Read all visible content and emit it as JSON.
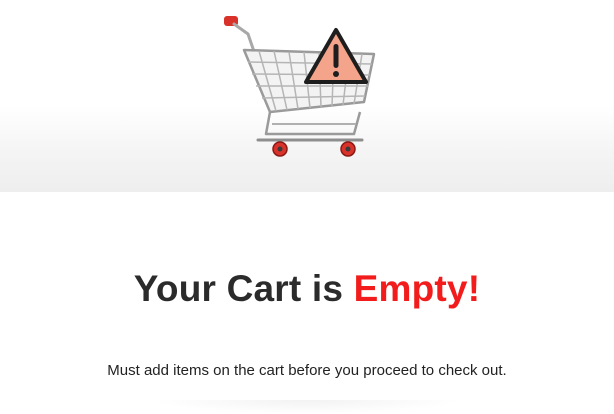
{
  "empty_cart": {
    "headline_prefix": "Your Cart is ",
    "headline_accent": "Empty!",
    "message": "Must add items on the cart before you proceed to check out."
  },
  "icons": {
    "cart": "shopping-cart-icon",
    "warning": "warning-icon"
  },
  "colors": {
    "accent": "#f21c1c",
    "headline_text": "#2b2b2b",
    "warning_fill": "#f4a48a"
  }
}
